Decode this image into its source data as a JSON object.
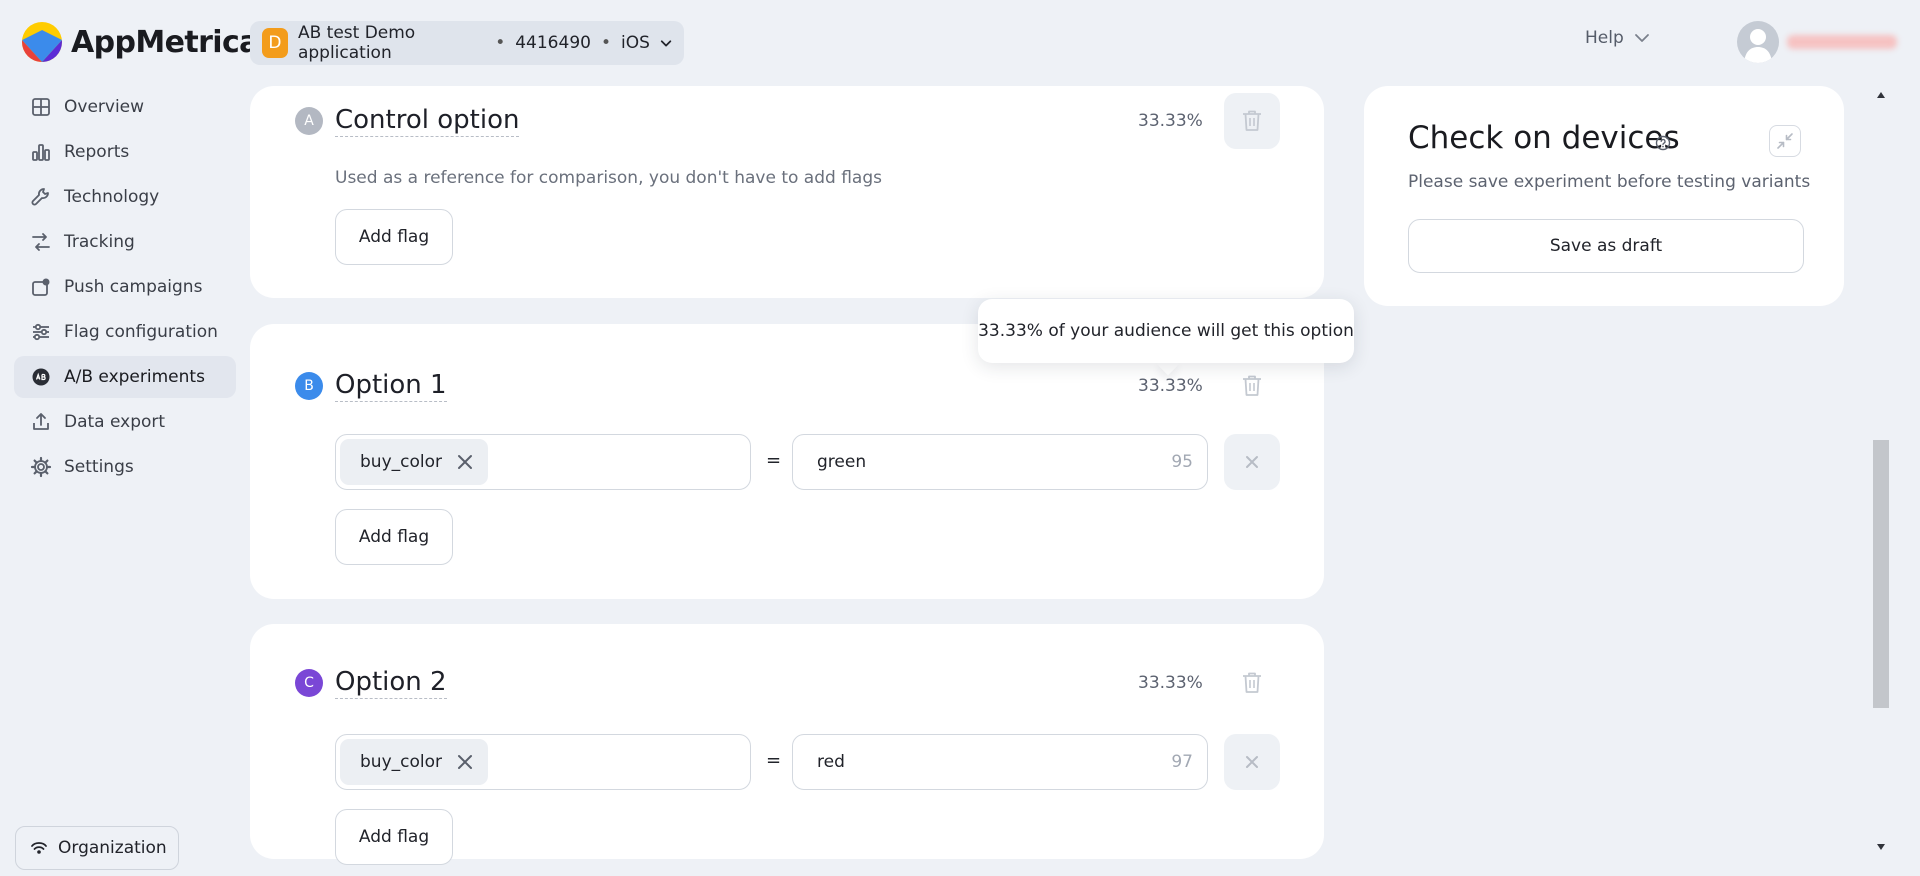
{
  "brand": {
    "name": "AppMetrica"
  },
  "app_selector": {
    "badge": "D",
    "name": "AB test Demo application",
    "separator": "•",
    "app_id": "4416490",
    "platform": "iOS"
  },
  "header": {
    "help": "Help"
  },
  "sidebar": {
    "items": [
      {
        "label": "Overview",
        "icon": "grid-icon"
      },
      {
        "label": "Reports",
        "icon": "bar-chart-icon"
      },
      {
        "label": "Technology",
        "icon": "wrench-icon"
      },
      {
        "label": "Tracking",
        "icon": "tracking-icon"
      },
      {
        "label": "Push campaigns",
        "icon": "push-icon"
      },
      {
        "label": "Flag configuration",
        "icon": "sliders-icon"
      },
      {
        "label": "A/B experiments",
        "icon": "ab-icon",
        "active": true
      },
      {
        "label": "Data export",
        "icon": "export-icon"
      },
      {
        "label": "Settings",
        "icon": "gear-icon"
      }
    ],
    "organization": "Organization"
  },
  "options": [
    {
      "letter": "A",
      "color": "#b3b8c2",
      "title": "Control option",
      "percent": "33.33%",
      "description": "Used as a reference for comparison, you don't have to add flags",
      "add_flag": "Add flag"
    },
    {
      "letter": "B",
      "color": "#3b8beb",
      "title": "Option 1",
      "percent": "33.33%",
      "flag": {
        "key": "buy_color",
        "value": "green",
        "count": "95"
      },
      "equals": "=",
      "add_flag": "Add flag"
    },
    {
      "letter": "C",
      "color": "#7a47d6",
      "title": "Option 2",
      "percent": "33.33%",
      "flag": {
        "key": "buy_color",
        "value": "red",
        "count": "97"
      },
      "equals": "=",
      "add_flag": "Add flag"
    }
  ],
  "tooltip": {
    "percent": "33.33%",
    "text": " of your audience will get this option"
  },
  "check_panel": {
    "title": "Check on devices",
    "subtitle": "Please save experiment before testing variants",
    "save_button": "Save as draft"
  }
}
